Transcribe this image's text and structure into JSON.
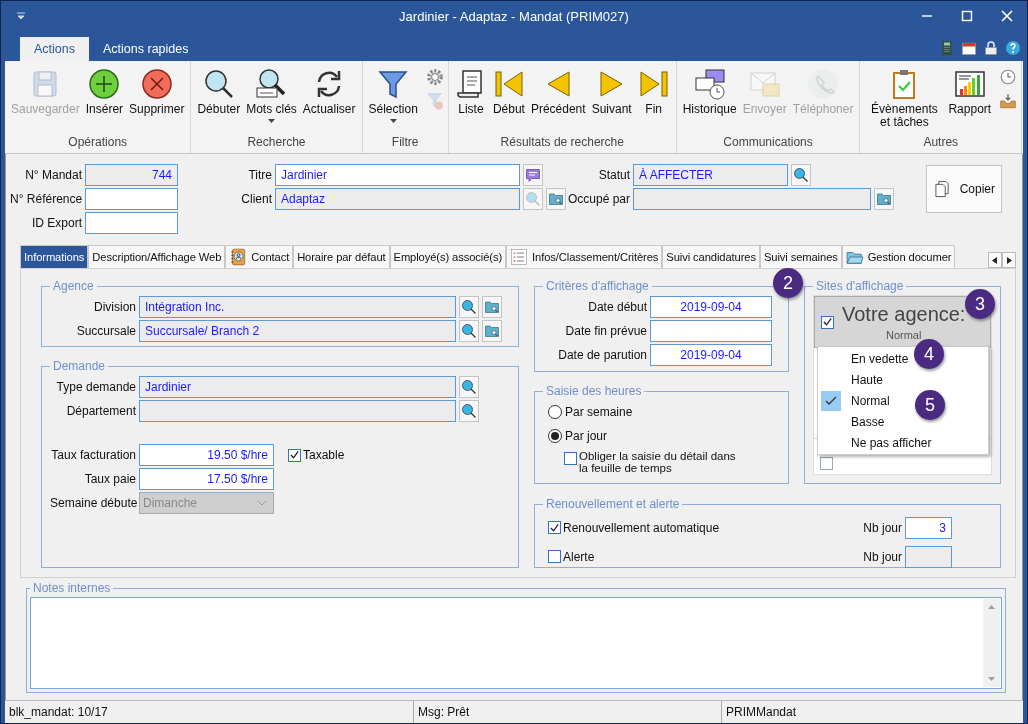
{
  "window": {
    "title": "Jardinier - Adaptaz - Mandat (PRIM027)"
  },
  "ribbon_tabs": [
    {
      "label": "Actions",
      "selected": true
    },
    {
      "label": "Actions rapides",
      "selected": false
    }
  ],
  "quick_tools": [
    {
      "kind": "calculator"
    },
    {
      "kind": "calendar"
    },
    {
      "kind": "lock"
    },
    {
      "kind": "help"
    }
  ],
  "ribbon_groups": [
    {
      "label": "Opérations",
      "buttons": [
        {
          "kind": "save",
          "label": "Sauvegarder",
          "disabled": true,
          "dropdown": false
        },
        {
          "kind": "plus",
          "label": "Insérer",
          "disabled": false,
          "dropdown": false
        },
        {
          "kind": "delete",
          "label": "Supprimer",
          "disabled": false,
          "dropdown": false
        }
      ]
    },
    {
      "label": "Recherche",
      "buttons": [
        {
          "kind": "search",
          "label": "Débuter",
          "disabled": false,
          "dropdown": false
        },
        {
          "kind": "keyword",
          "label": "Mots clés",
          "disabled": false,
          "dropdown": true
        },
        {
          "kind": "refresh",
          "label": "Actualiser",
          "disabled": false,
          "dropdown": false
        }
      ]
    },
    {
      "label": "Filtre",
      "buttons": [
        {
          "kind": "filter",
          "label": "Sélection",
          "disabled": false,
          "dropdown": true
        }
      ],
      "small_buttons": [
        {
          "kind": "gear",
          "disabled": false
        },
        {
          "kind": "filter-clear",
          "disabled": true
        }
      ]
    },
    {
      "label": "Résultats de recherche",
      "buttons": [
        {
          "kind": "list",
          "label": "Liste",
          "disabled": false,
          "dropdown": false
        },
        {
          "kind": "first",
          "label": "Début",
          "disabled": false,
          "dropdown": false
        },
        {
          "kind": "prev",
          "label": "Précédent",
          "disabled": false,
          "dropdown": false
        },
        {
          "kind": "next",
          "label": "Suivant",
          "disabled": false,
          "dropdown": false
        },
        {
          "kind": "last",
          "label": "Fin",
          "disabled": false,
          "dropdown": false
        }
      ]
    },
    {
      "label": "Communications",
      "buttons": [
        {
          "kind": "history",
          "label": "Historique",
          "disabled": false,
          "dropdown": false
        },
        {
          "kind": "mail",
          "label": "Envoyer",
          "disabled": true,
          "dropdown": false
        },
        {
          "kind": "phone",
          "label": "Téléphoner",
          "disabled": true,
          "dropdown": false
        }
      ]
    },
    {
      "label": "Autres",
      "buttons": [
        {
          "kind": "tasks",
          "label": "Évènements et tâches",
          "disabled": false,
          "dropdown": false
        },
        {
          "kind": "report",
          "label": "Rapport",
          "disabled": false,
          "dropdown": false
        }
      ],
      "small_buttons": [
        {
          "kind": "clock",
          "disabled": false
        },
        {
          "kind": "inbox",
          "disabled": false
        }
      ]
    }
  ],
  "header": {
    "column_1": [
      {
        "label": "N° Mandat",
        "value": "744",
        "readonly": true
      },
      {
        "label": "N° Référence",
        "readonly": false
      },
      {
        "label": "ID Export",
        "readonly": false
      }
    ],
    "column_2": [
      {
        "label": "Titre",
        "value": "Jardinier",
        "readonly": false,
        "buttons": [
          {
            "kind": "note",
            "disabled": false
          }
        ]
      },
      {
        "label": "Client",
        "value": "Adaptaz",
        "readonly": true,
        "buttons": [
          {
            "kind": "search",
            "disabled": true
          },
          {
            "kind": "folder-search",
            "disabled": false
          }
        ]
      }
    ],
    "column_3": [
      {
        "label": "Statut",
        "value": "À AFFECTER",
        "readonly": true,
        "buttons": [
          {
            "kind": "search",
            "disabled": false
          }
        ]
      },
      {
        "label": "Occupé par",
        "readonly": true,
        "buttons": [
          {
            "kind": "folder-search",
            "disabled": false
          }
        ]
      }
    ],
    "copy_button": {
      "label": "Copier"
    }
  },
  "tabs": [
    {
      "label": "Informations",
      "selected": true
    },
    {
      "label": "Description/Affichage Web",
      "selected": false
    },
    {
      "label": "Contact",
      "kind": "contact",
      "selected": false
    },
    {
      "label": "Horaire par défaut",
      "selected": false
    },
    {
      "label": "Employé(s) associé(s)",
      "selected": false
    },
    {
      "label": "Infos/Classement/Critères",
      "kind": "list-tab",
      "selected": false
    },
    {
      "label": "Suivi candidatures",
      "selected": false
    },
    {
      "label": "Suivi semaines",
      "selected": false
    },
    {
      "label": "Gestion documer",
      "kind": "folder",
      "selected": false
    }
  ],
  "agence": {
    "title": "Agence",
    "fields": [
      {
        "label": "Division",
        "value": "Intégration Inc.",
        "readonly": true,
        "buttons": [
          {
            "kind": "search",
            "disabled": false
          },
          {
            "kind": "folder-search",
            "disabled": false
          }
        ]
      },
      {
        "label": "Succursale",
        "value": "Succursale/ Branch 2",
        "readonly": true,
        "buttons": [
          {
            "kind": "search",
            "disabled": false
          },
          {
            "kind": "folder-search",
            "disabled": false
          }
        ]
      }
    ]
  },
  "demande": {
    "title": "Demande",
    "fields": [
      {
        "label": "Type demande",
        "value": "Jardinier",
        "readonly": true,
        "buttons": [
          {
            "kind": "search",
            "disabled": false
          }
        ]
      },
      {
        "label": "Département",
        "readonly": true,
        "buttons": [
          {
            "kind": "search",
            "disabled": false
          }
        ]
      }
    ],
    "rates": [
      {
        "label": "Taux facturation",
        "value": "19.50 $/hre",
        "readonly": false
      },
      {
        "label": "Taux paie",
        "value": "17.50 $/hre",
        "readonly": false
      }
    ],
    "taxable": {
      "label": "Taxable",
      "checked": true
    },
    "week_start": {
      "label": "Semaine débute",
      "value": "Dimanche",
      "disabled": true
    }
  },
  "criteres": {
    "title": "Critères d'affichage",
    "fields": [
      {
        "label": "Date début",
        "value": "2019-09-04",
        "readonly": false
      },
      {
        "label": "Date fin prévue",
        "readonly": false
      },
      {
        "label": "Date de parution",
        "value": "2019-09-04",
        "readonly": false
      }
    ]
  },
  "saisie": {
    "title": "Saisie des heures",
    "options": [
      {
        "label": "Par semaine",
        "selected": false
      },
      {
        "label": "Par jour",
        "selected": true
      }
    ],
    "detail": {
      "label": "Obliger la saisie du détail dans la feuille de temps",
      "checked": false
    }
  },
  "sites": {
    "title": "Sites d'affichage",
    "items": [
      {
        "name": "Votre agence:",
        "priority": "Normal",
        "checked": true,
        "expanded": true
      },
      {
        "checked": false,
        "expanded": false
      }
    ]
  },
  "priority_menu": {
    "items": [
      {
        "label": "En vedette",
        "selected": false
      },
      {
        "label": "Haute",
        "selected": false
      },
      {
        "label": "Normal",
        "selected": true
      },
      {
        "label": "Basse",
        "selected": false
      },
      {
        "label": "Ne pas afficher",
        "selected": false
      }
    ]
  },
  "renouvellement": {
    "title": "Renouvellement et alerte",
    "rows": [
      {
        "label": "Renouvellement automatique",
        "checked": true,
        "days_label": "Nb jour",
        "days": "3",
        "days_disabled": false
      },
      {
        "label": "Alerte",
        "checked": false,
        "days_label": "Nb jour",
        "days_disabled": true
      }
    ]
  },
  "notes": {
    "title": "Notes internes"
  },
  "callouts": [
    {
      "number": "2"
    },
    {
      "number": "3"
    },
    {
      "number": "4"
    },
    {
      "number": "5"
    }
  ],
  "status_bar": [
    "blk_mandat: 10/17",
    "Msg: Prêt",
    "PRIMMandat"
  ]
}
